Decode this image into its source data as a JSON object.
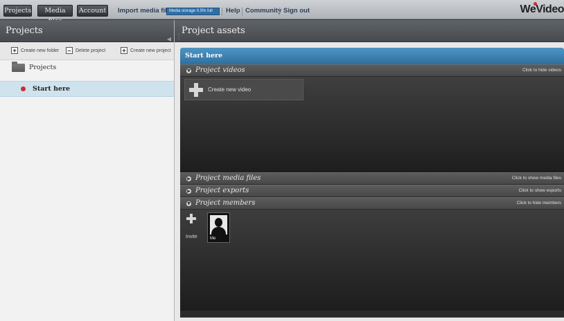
{
  "topbar": {
    "projects_label": "Projects",
    "media_files_label": "Media files",
    "account_label": "Account",
    "import_label": "Import media files",
    "storage_text": "Media storage 0.5% full",
    "help_label": "Help",
    "community_label": "Community",
    "signout_label": "Sign out",
    "logo_text": "WeVideo"
  },
  "left_panel": {
    "title": "Projects",
    "toolbar": {
      "create_folder": "Create new folder",
      "delete_project": "Delete project",
      "create_project": "Create new project"
    },
    "folder_label": "Projects",
    "project_label": "Start here"
  },
  "right_panel": {
    "title": "Project assets",
    "card_title": "Start here",
    "sections": {
      "videos": {
        "label": "Project videos",
        "hint": "Click to hide videos"
      },
      "media": {
        "label": "Project media files",
        "hint": "Click to show media files"
      },
      "exports": {
        "label": "Project exports",
        "hint": "Click to show exports"
      },
      "members": {
        "label": "Project members",
        "hint": "Click to hide members"
      }
    },
    "create_video_label": "Create new video",
    "invite_label": "Invite",
    "member_name": "Me"
  },
  "colors": {
    "accent": "#3a82b6",
    "selected_row": "#cfe3ef",
    "status_dot": "#cc2f2f"
  }
}
